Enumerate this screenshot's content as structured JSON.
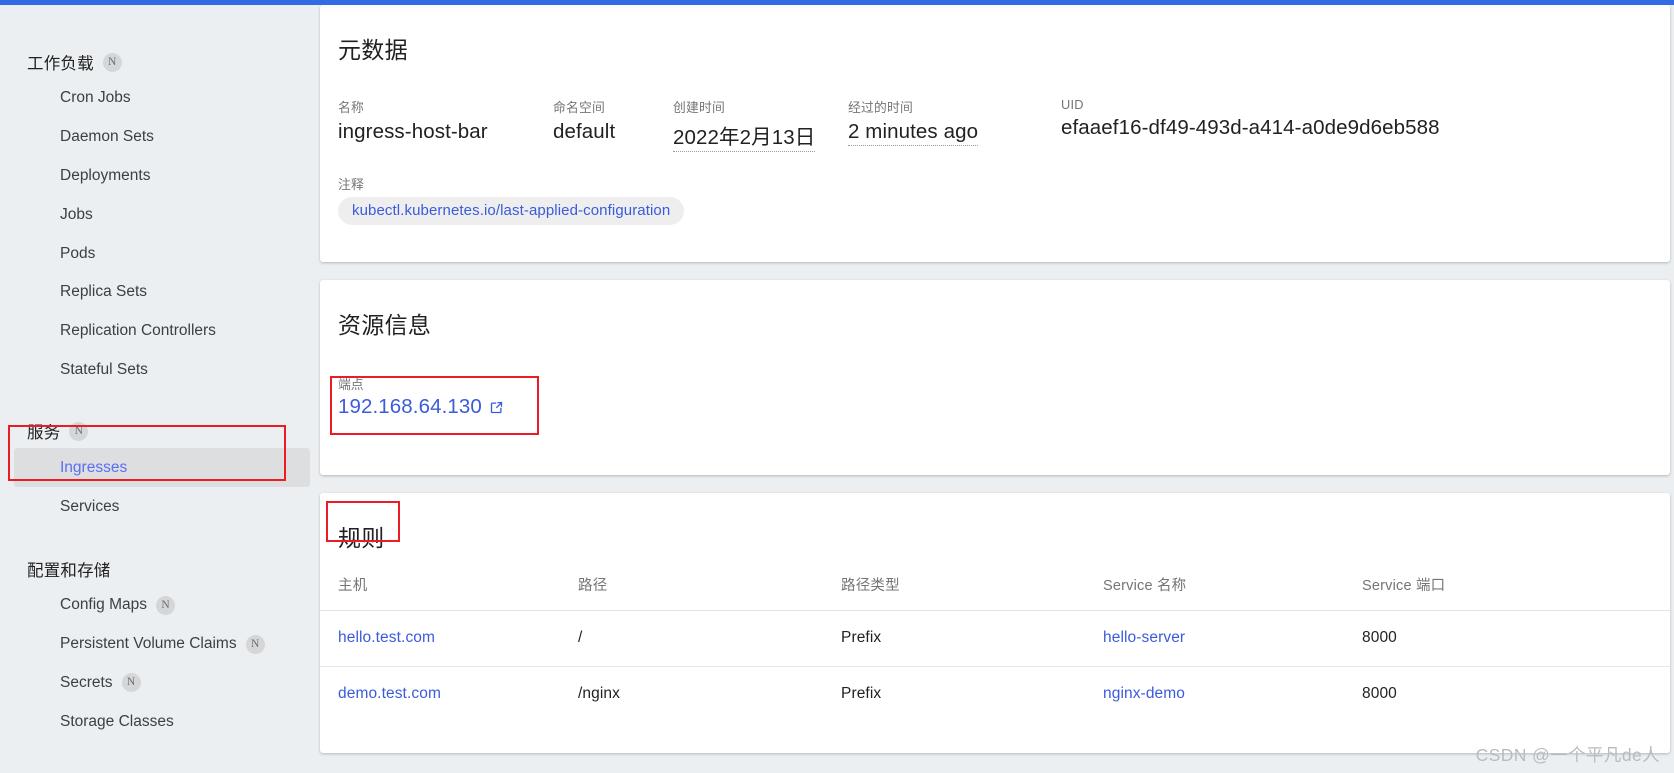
{
  "theme": {
    "accent_blue": "#326ce5",
    "link_blue": "#3b5bdb",
    "annotation_red": "#ec1c24",
    "page_bg": "#eceff1",
    "card_bg": "#ffffff"
  },
  "sidebar": {
    "groups": [
      {
        "title": "工作负载",
        "badge": "N",
        "items": [
          {
            "label": "Cron Jobs",
            "selected": false
          },
          {
            "label": "Daemon Sets",
            "selected": false
          },
          {
            "label": "Deployments",
            "selected": false
          },
          {
            "label": "Jobs",
            "selected": false
          },
          {
            "label": "Pods",
            "selected": false
          },
          {
            "label": "Replica Sets",
            "selected": false
          },
          {
            "label": "Replication Controllers",
            "selected": false
          },
          {
            "label": "Stateful Sets",
            "selected": false
          }
        ]
      },
      {
        "title": "服务",
        "badge": "N",
        "items": [
          {
            "label": "Ingresses",
            "selected": true
          },
          {
            "label": "Services",
            "selected": false
          }
        ]
      },
      {
        "title": "配置和存储",
        "badge": "",
        "items": [
          {
            "label": "Config Maps",
            "badge": "N",
            "selected": false
          },
          {
            "label": "Persistent Volume Claims",
            "badge": "N",
            "selected": false
          },
          {
            "label": "Secrets",
            "badge": "N",
            "selected": false
          },
          {
            "label": "Storage Classes",
            "selected": false
          }
        ]
      }
    ]
  },
  "metadata_card": {
    "title": "元数据",
    "fields": [
      {
        "label": "名称",
        "value": "ingress-host-bar"
      },
      {
        "label": "命名空间",
        "value": "default"
      },
      {
        "label": "创建时间",
        "value": "2022年2月13日"
      },
      {
        "label": "经过的时间",
        "value": "2 minutes ago"
      },
      {
        "label": "UID",
        "value": "efaaef16-df49-493d-a414-a0de9d6eb588"
      }
    ],
    "annotations_label": "注释",
    "annotation_chip": "kubectl.kubernetes.io/last-applied-configuration"
  },
  "resource_card": {
    "title": "资源信息",
    "endpoint_label": "端点",
    "endpoint_value": "192.168.64.130",
    "endpoint_icon": "external-link-icon"
  },
  "rules_card": {
    "title": "规则",
    "columns": [
      "主机",
      "路径",
      "路径类型",
      "Service 名称",
      "Service 端口"
    ],
    "rows": [
      {
        "host": "hello.test.com",
        "path": "/",
        "path_type": "Prefix",
        "service_name": "hello-server",
        "service_port": "8000"
      },
      {
        "host": "demo.test.com",
        "path": "/nginx",
        "path_type": "Prefix",
        "service_name": "nginx-demo",
        "service_port": "8000"
      }
    ]
  },
  "watermark": "CSDN @一个平凡de人"
}
